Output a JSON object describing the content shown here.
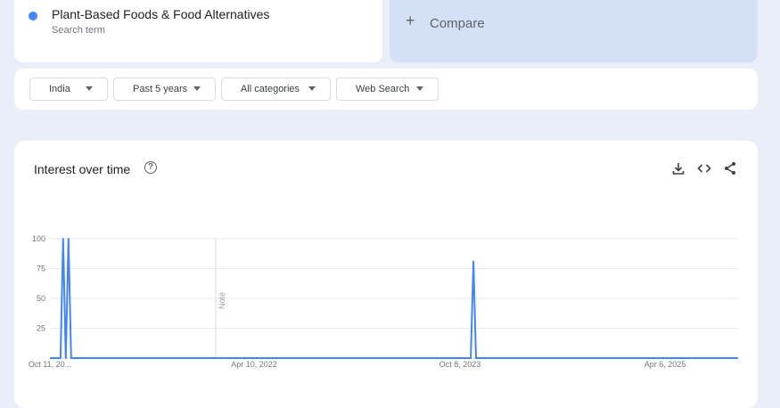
{
  "search_term": {
    "name": "Plant-Based Foods & Food Alternatives",
    "subtitle": "Search term",
    "color": "#4285f4"
  },
  "compare": {
    "plus": "+",
    "label": "Compare"
  },
  "filters": {
    "region": "India",
    "time": "Past 5 years",
    "category": "All categories",
    "search_type": "Web Search"
  },
  "chart_title": "Interest over time",
  "toolbar_icons": [
    "download-icon",
    "embed-code-icon",
    "share-icon"
  ],
  "chart_data": {
    "type": "line",
    "title": "Interest over time",
    "xlabel": "",
    "ylabel": "",
    "ylim": [
      0,
      100
    ],
    "yticks": [
      "100",
      "75",
      "50",
      "25"
    ],
    "xticks": [
      "Oct 11, 20...",
      "Apr 10, 2022",
      "Oct 8, 2023",
      "Apr 6, 2025"
    ],
    "grid": true,
    "annotation": "Note",
    "series": [
      {
        "color": "#4285f4",
        "x": [
          "2020-10-11",
          "2020-11-08",
          "2020-11-15",
          "2020-11-22",
          "2020-11-29",
          "2020-12-06",
          "2022-04-10",
          "2023-10-08",
          "2023-10-29",
          "2023-11-05",
          "2023-11-12",
          "2023-11-19",
          "2025-04-06",
          "2025-10-05"
        ],
        "values": [
          0,
          0,
          100,
          0,
          100,
          0,
          0,
          0,
          0,
          81,
          0,
          0,
          0,
          0
        ]
      }
    ]
  }
}
